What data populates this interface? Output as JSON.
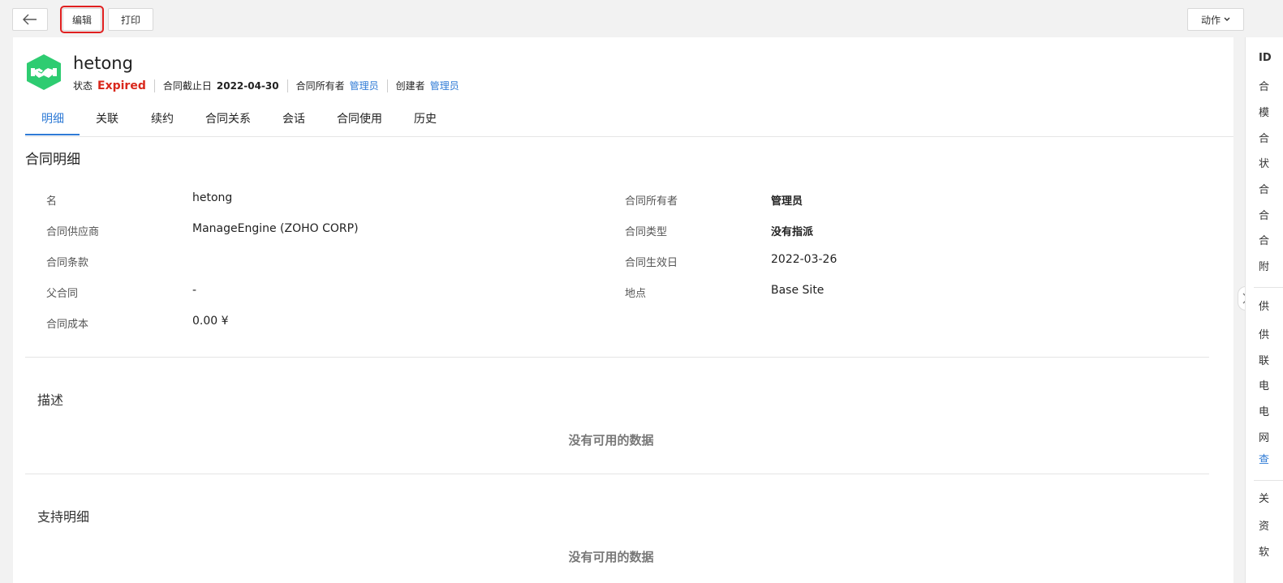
{
  "toolbar": {
    "edit_label": "编辑",
    "print_label": "打印",
    "actions_label": "动作"
  },
  "header": {
    "title": "hetong",
    "status_label": "状态",
    "status_value": "Expired",
    "end_date_label": "合同截止日",
    "end_date_value": "2022-04-30",
    "owner_label": "合同所有者",
    "owner_value": "管理员",
    "creator_label": "创建者",
    "creator_value": "管理员"
  },
  "tabs": [
    {
      "label": "明细"
    },
    {
      "label": "关联"
    },
    {
      "label": "续约"
    },
    {
      "label": "合同关系"
    },
    {
      "label": "会话"
    },
    {
      "label": "合同使用"
    },
    {
      "label": "历史"
    }
  ],
  "details": {
    "section_title": "合同明细",
    "left": [
      {
        "label": "名",
        "value": "hetong"
      },
      {
        "label": "合同供应商",
        "value": "ManageEngine (ZOHO CORP)"
      },
      {
        "label": "合同条款",
        "value": ""
      },
      {
        "label": "父合同",
        "value": "-"
      },
      {
        "label": "合同成本",
        "value": "0.00 ¥"
      }
    ],
    "right": [
      {
        "label": "合同所有者",
        "value": "管理员"
      },
      {
        "label": "合同类型",
        "value": "没有指派"
      },
      {
        "label": "合同生效日",
        "value": "2022-03-26"
      },
      {
        "label": "地点",
        "value": "Base Site"
      }
    ]
  },
  "description": {
    "title": "描述",
    "empty_text": "没有可用的数据"
  },
  "support": {
    "title": "支持明细",
    "empty_text": "没有可用的数据"
  },
  "right_panel": {
    "items": [
      "ID",
      "合",
      "模",
      "合",
      "状",
      "合",
      "合",
      "合",
      "附"
    ],
    "vendor_items": [
      "供",
      "供",
      "联",
      "电",
      "电",
      "网"
    ],
    "view_link": "查",
    "related_items": [
      "关",
      "资",
      "软"
    ]
  },
  "colors": {
    "accent": "#2f7bd6",
    "expired": "#d9281c",
    "logo_green": "#2ecc71",
    "highlight_box": "#e02020"
  }
}
